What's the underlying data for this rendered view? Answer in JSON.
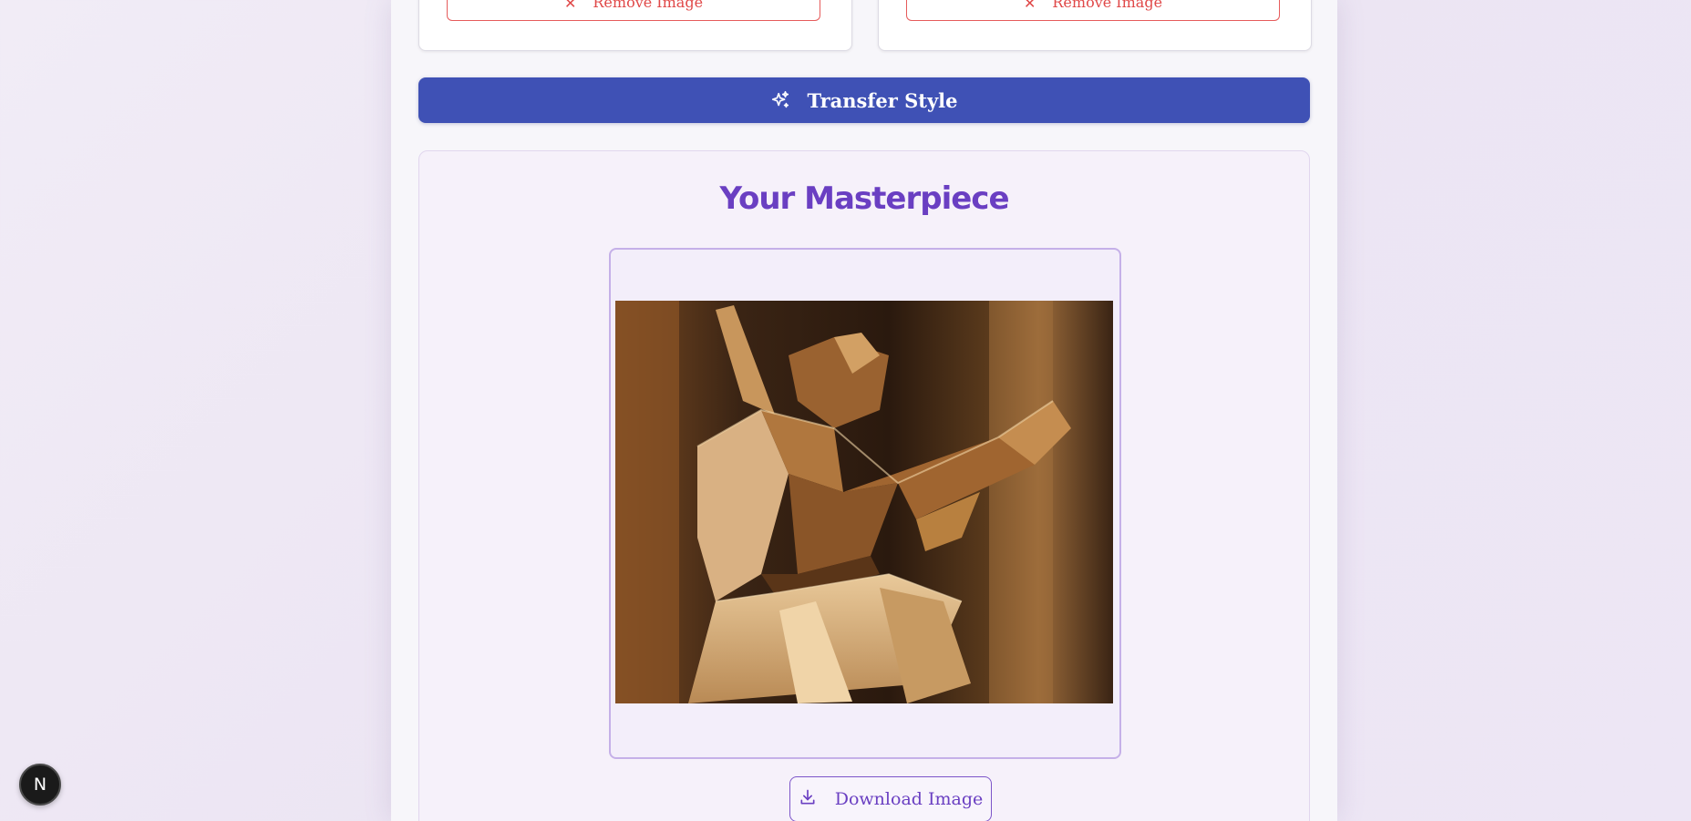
{
  "upload_cards": {
    "left": {
      "remove_label": "Remove Image"
    },
    "right": {
      "remove_label": "Remove Image"
    }
  },
  "actions": {
    "transfer_label": "Transfer Style"
  },
  "result": {
    "title": "Your Masterpiece",
    "image_alt": "Stylized cubist painting of a ballerina",
    "download_label": "Download Image"
  },
  "dev_badge": {
    "letter": "N"
  },
  "icons": {
    "remove": "close-icon",
    "transfer": "sparkles-icon",
    "download": "download-icon"
  },
  "colors": {
    "primary": "#3f51b5",
    "accent": "#6a3fc2",
    "danger": "#e04848",
    "frame_border": "#c5b0e8"
  }
}
